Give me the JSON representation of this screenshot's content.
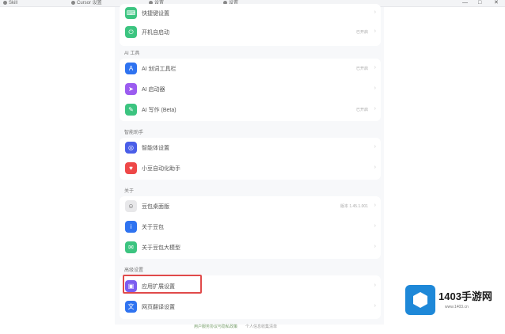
{
  "tabs": [
    {
      "label": "Skill"
    },
    {
      "label": "Cursor 设置"
    },
    {
      "label": "设置"
    },
    {
      "label": "设置"
    }
  ],
  "window_controls": [
    "—",
    "□",
    "✕"
  ],
  "sections": [
    {
      "title": "",
      "rows": [
        {
          "label": "快捷键设置",
          "value": "",
          "icon": "keyboard-icon",
          "color": "#3cc480"
        },
        {
          "label": "开机自启动",
          "value": "已开启",
          "icon": "power-icon",
          "color": "#3cc480"
        }
      ]
    },
    {
      "title": "AI 工具",
      "rows": [
        {
          "label": "AI 划词工具栏",
          "value": "已开启",
          "icon": "ai-toolbar-icon",
          "color": "#2f73f0"
        },
        {
          "label": "AI 启动器",
          "value": "",
          "icon": "ai-launcher-icon",
          "color": "#9b5cf0"
        },
        {
          "label": "AI 写作 (Beta)",
          "value": "已开启",
          "icon": "ai-write-icon",
          "color": "#3cc480"
        }
      ]
    },
    {
      "title": "智能助手",
      "rows": [
        {
          "label": "智能体设置",
          "value": "",
          "icon": "agent-icon",
          "color": "#4a5ee8"
        },
        {
          "label": "小豆自动化助手",
          "value": "",
          "icon": "bot-icon",
          "color": "#ee4848"
        }
      ]
    },
    {
      "title": "关于",
      "rows": [
        {
          "label": "豆包桌面版",
          "value": "版本 1.45.1.001",
          "icon": "avatar-icon",
          "color": "#ffffff"
        },
        {
          "label": "关于豆包",
          "value": "",
          "icon": "info-icon",
          "color": "#2f73f0"
        },
        {
          "label": "关于豆包大模型",
          "value": "",
          "icon": "chat-icon",
          "color": "#3cc480"
        }
      ]
    },
    {
      "title": "高级设置",
      "rows": [
        {
          "label": "应用扩展设置",
          "value": "",
          "icon": "extension-icon",
          "color": "#7b5cf0"
        },
        {
          "label": "网页翻译设置",
          "value": "",
          "icon": "translate-icon",
          "color": "#2f73f0"
        }
      ]
    }
  ],
  "footer": {
    "left": "用户服务协议与隐私政策",
    "right": "个人信息收集清单"
  },
  "watermark": {
    "title": "1403手游网",
    "sub": "www.1403.cn"
  },
  "colors": {
    "highlight": "#e04a4a",
    "brand": "#1e88d8"
  }
}
